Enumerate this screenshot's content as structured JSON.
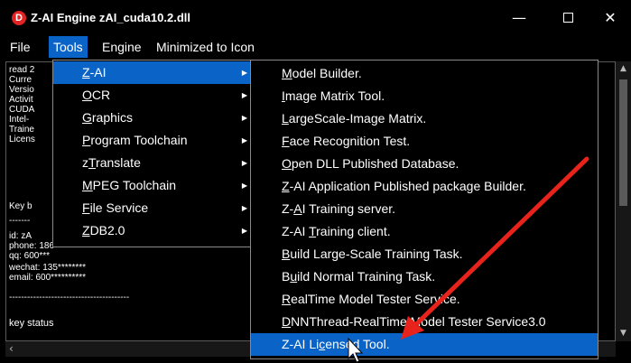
{
  "window": {
    "title": "Z-AI Engine zAI_cuda10.2.dll",
    "icon_letter": "D",
    "minimize": "—",
    "close": "✕"
  },
  "menubar": [
    "File",
    "Tools",
    "Engine",
    "Minimized to Icon"
  ],
  "log_lines": [
    "read 2",
    "Curre",
    "Versio",
    "Activit",
    "CUDA",
    "Intel-",
    "Traine",
    "Licens",
    "Key b",
    "-------",
    "id: zA",
    "phone: 186",
    "qq: 600***",
    "wechat: 135********",
    "email: 600**********",
    "----------------------------------------",
    "key status"
  ],
  "tools_menu": [
    {
      "underline": "Z",
      "rest": "-AI",
      "arrow": "▶"
    },
    {
      "underline": "O",
      "rest": "CR",
      "arrow": "▶"
    },
    {
      "underline": "G",
      "rest": "raphics",
      "arrow": "▶"
    },
    {
      "underline": "P",
      "rest": "rogram Toolchain",
      "arrow": "▶"
    },
    {
      "pre": "z",
      "underline": "T",
      "rest": "ranslate",
      "arrow": "▶"
    },
    {
      "underline": "M",
      "rest": "PEG Toolchain",
      "arrow": "▶"
    },
    {
      "underline": "F",
      "rest": "ile Service",
      "arrow": "▶"
    },
    {
      "underline": "Z",
      "rest": "DB2.0",
      "arrow": "▶"
    }
  ],
  "zai_submenu": [
    {
      "pre": "",
      "underline": "M",
      "rest": "odel Builder."
    },
    {
      "pre": "",
      "underline": "I",
      "rest": "mage Matrix Tool."
    },
    {
      "pre": "",
      "underline": "L",
      "rest": "argeScale-Image Matrix."
    },
    {
      "pre": "",
      "underline": "F",
      "rest": "ace Recognition Test."
    },
    {
      "pre": "",
      "underline": "O",
      "rest": "pen DLL Published Database."
    },
    {
      "pre": "",
      "underline": "Z",
      "rest": "-AI Application Published package Builder."
    },
    {
      "pre": "Z-",
      "underline": "A",
      "rest": "I Training server."
    },
    {
      "pre": "Z-AI ",
      "underline": "T",
      "rest": "raining client."
    },
    {
      "pre": "",
      "underline": "B",
      "rest": "uild Large-Scale Training Task."
    },
    {
      "pre": "B",
      "underline": "u",
      "rest": "ild Normal Training Task."
    },
    {
      "pre": "",
      "underline": "R",
      "rest": "ealTime Model Tester Service."
    },
    {
      "pre": "",
      "underline": "D",
      "rest": "NNThread-RealTime Model Tester Service3.0"
    },
    {
      "pre": "Z-AI Li",
      "underline": "c",
      "rest": "ensed Tool."
    }
  ],
  "colors": {
    "highlight": "#0a64c8",
    "annotation_arrow": "#e8231b"
  }
}
